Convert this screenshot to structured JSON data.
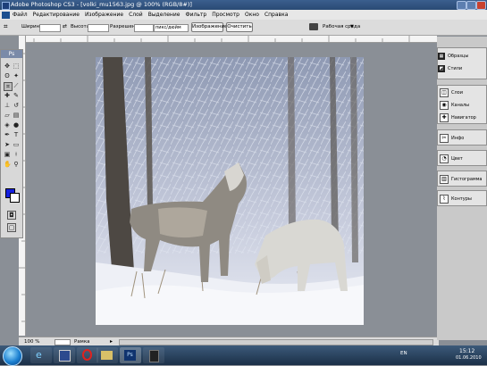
{
  "window": {
    "title": "Adobe Photoshop CS3 - [volki_mu1563.jpg @ 100% (RGB/8#)]"
  },
  "menu": [
    "Файл",
    "Редактирование",
    "Изображение",
    "Слой",
    "Выделение",
    "Фильтр",
    "Просмотр",
    "Окно",
    "Справка"
  ],
  "options": {
    "width_label": "Ширина:",
    "height_label": "Высота:",
    "resolution_label": "Разрешение:",
    "resolution_unit": "пикс/дюйм",
    "image_button": "Изображение",
    "clear_button": "Очистить",
    "workspace_label": "Рабочая среда"
  },
  "toolbox": {
    "header": "Ps"
  },
  "panels": {
    "group1": [
      "Образцы",
      "Стили"
    ],
    "group2": [
      "Слои",
      "Каналы",
      "Навигатор"
    ],
    "group3": [
      "Инфо"
    ],
    "group4": [
      "Цвет"
    ],
    "group5": [
      "Гистограмма"
    ],
    "group6": [
      "Контуры"
    ]
  },
  "status": {
    "zoom": "100 %",
    "layer": "Рамка"
  },
  "taskbar": {
    "lang": "EN",
    "time": "15:12",
    "date": "01.06.2010"
  },
  "colors": {
    "foreground": "#1620e0",
    "background": "#ffffff",
    "accent": "#2a4a74"
  }
}
